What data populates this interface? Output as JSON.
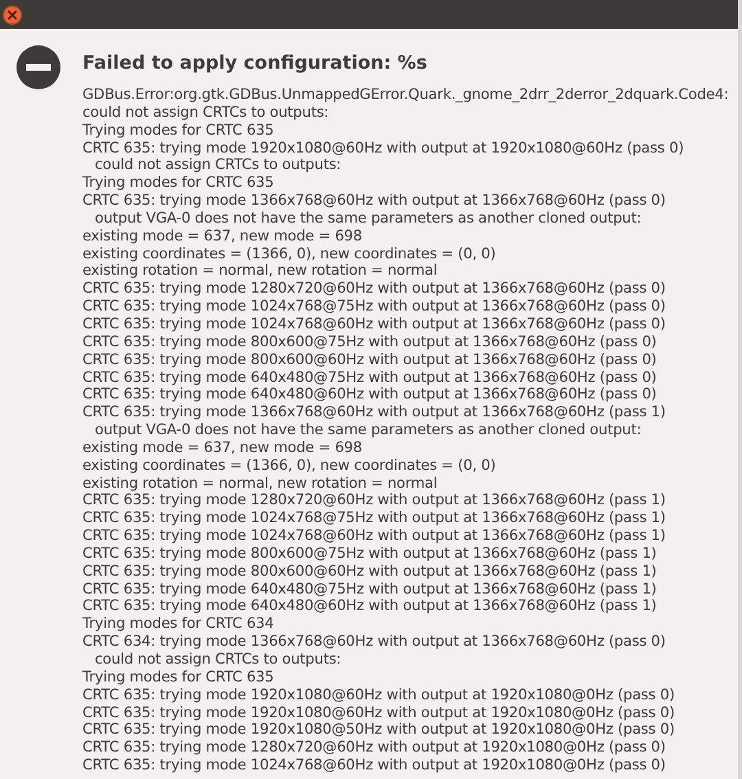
{
  "window": {
    "title_bar": {
      "close_button": true
    }
  },
  "dialog": {
    "title": "Failed to apply configuration: %s",
    "lines": [
      {
        "kind": "plain",
        "text": "GDBus.Error:org.gtk.GDBus.UnmappedGError.Quark._gnome_2drr_2derror_2dquark.Code4:"
      },
      {
        "kind": "plain",
        "text": "could not assign CRTCs to outputs:"
      },
      {
        "kind": "plain",
        "text": "Trying modes for CRTC 635"
      },
      {
        "kind": "plain",
        "text": "CRTC 635: trying mode 1920x1080@60Hz with output at 1920x1080@60Hz (pass 0)"
      },
      {
        "kind": "indented",
        "text": "could not assign CRTCs to outputs:"
      },
      {
        "kind": "plain",
        "text": "Trying modes for CRTC 635"
      },
      {
        "kind": "plain",
        "text": "CRTC 635: trying mode 1366x768@60Hz with output at 1366x768@60Hz (pass 0)"
      },
      {
        "kind": "indented",
        "text": "output VGA-0 does not have the same parameters as another cloned output:"
      },
      {
        "kind": "plain",
        "text": "existing mode = 637, new mode = 698"
      },
      {
        "kind": "plain",
        "text": "existing coordinates = (1366, 0), new coordinates = (0, 0)"
      },
      {
        "kind": "plain",
        "text": "existing rotation = normal, new rotation = normal"
      },
      {
        "kind": "plain",
        "text": "CRTC 635: trying mode 1280x720@60Hz with output at 1366x768@60Hz (pass 0)"
      },
      {
        "kind": "plain",
        "text": "CRTC 635: trying mode 1024x768@75Hz with output at 1366x768@60Hz (pass 0)"
      },
      {
        "kind": "plain",
        "text": "CRTC 635: trying mode 1024x768@60Hz with output at 1366x768@60Hz (pass 0)"
      },
      {
        "kind": "plain",
        "text": "CRTC 635: trying mode 800x600@75Hz with output at 1366x768@60Hz (pass 0)"
      },
      {
        "kind": "plain",
        "text": "CRTC 635: trying mode 800x600@60Hz with output at 1366x768@60Hz (pass 0)"
      },
      {
        "kind": "plain",
        "text": "CRTC 635: trying mode 640x480@75Hz with output at 1366x768@60Hz (pass 0)"
      },
      {
        "kind": "plain",
        "text": "CRTC 635: trying mode 640x480@60Hz with output at 1366x768@60Hz (pass 0)"
      },
      {
        "kind": "plain",
        "text": "CRTC 635: trying mode 1366x768@60Hz with output at 1366x768@60Hz (pass 1)"
      },
      {
        "kind": "indented",
        "text": "output VGA-0 does not have the same parameters as another cloned output:"
      },
      {
        "kind": "plain",
        "text": "existing mode = 637, new mode = 698"
      },
      {
        "kind": "plain",
        "text": "existing coordinates = (1366, 0), new coordinates = (0, 0)"
      },
      {
        "kind": "plain",
        "text": "existing rotation = normal, new rotation = normal"
      },
      {
        "kind": "plain",
        "text": "CRTC 635: trying mode 1280x720@60Hz with output at 1366x768@60Hz (pass 1)"
      },
      {
        "kind": "plain",
        "text": "CRTC 635: trying mode 1024x768@75Hz with output at 1366x768@60Hz (pass 1)"
      },
      {
        "kind": "plain",
        "text": "CRTC 635: trying mode 1024x768@60Hz with output at 1366x768@60Hz (pass 1)"
      },
      {
        "kind": "plain",
        "text": "CRTC 635: trying mode 800x600@75Hz with output at 1366x768@60Hz (pass 1)"
      },
      {
        "kind": "plain",
        "text": "CRTC 635: trying mode 800x600@60Hz with output at 1366x768@60Hz (pass 1)"
      },
      {
        "kind": "plain",
        "text": "CRTC 635: trying mode 640x480@75Hz with output at 1366x768@60Hz (pass 1)"
      },
      {
        "kind": "plain",
        "text": "CRTC 635: trying mode 640x480@60Hz with output at 1366x768@60Hz (pass 1)"
      },
      {
        "kind": "plain",
        "text": "Trying modes for CRTC 634"
      },
      {
        "kind": "plain",
        "text": "CRTC 634: trying mode 1366x768@60Hz with output at 1366x768@60Hz (pass 0)"
      },
      {
        "kind": "indented",
        "text": "could not assign CRTCs to outputs:"
      },
      {
        "kind": "plain",
        "text": "Trying modes for CRTC 635"
      },
      {
        "kind": "plain",
        "text": "CRTC 635: trying mode 1920x1080@60Hz with output at 1920x1080@0Hz (pass 0)"
      },
      {
        "kind": "plain",
        "text": "CRTC 635: trying mode 1920x1080@60Hz with output at 1920x1080@0Hz (pass 0)"
      },
      {
        "kind": "plain",
        "text": "CRTC 635: trying mode 1920x1080@50Hz with output at 1920x1080@0Hz (pass 0)"
      },
      {
        "kind": "plain",
        "text": "CRTC 635: trying mode 1280x720@60Hz with output at 1920x1080@0Hz (pass 0)"
      },
      {
        "kind": "plain",
        "text": "CRTC 635: trying mode 1024x768@60Hz with output at 1920x1080@0Hz (pass 0)"
      }
    ]
  }
}
